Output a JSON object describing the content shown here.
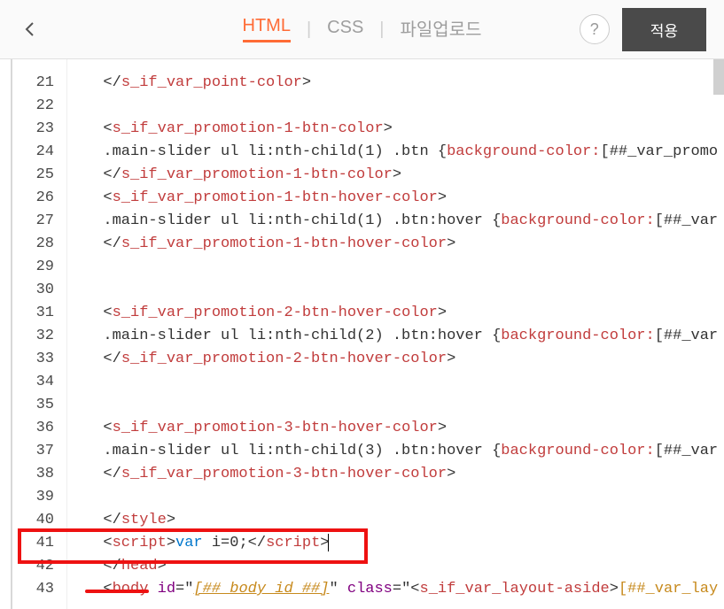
{
  "header": {
    "tabs": {
      "html": "HTML",
      "css": "CSS",
      "upload": "파일업로드"
    },
    "help": "?",
    "apply": "적용"
  },
  "lines": [
    {
      "n": 21,
      "segs": [
        {
          "t": "  </",
          "c": "c-plain"
        },
        {
          "t": "s_if_var_point-color",
          "c": "c-tag"
        },
        {
          "t": ">",
          "c": "c-plain"
        }
      ]
    },
    {
      "n": 22,
      "segs": []
    },
    {
      "n": 23,
      "segs": [
        {
          "t": "  <",
          "c": "c-plain"
        },
        {
          "t": "s_if_var_promotion-1-btn-color",
          "c": "c-tag"
        },
        {
          "t": ">",
          "c": "c-plain"
        }
      ]
    },
    {
      "n": 24,
      "segs": [
        {
          "t": "  .main-slider ul li:nth-child(1) .btn {",
          "c": "c-plain"
        },
        {
          "t": "background-color:",
          "c": "c-prop"
        },
        {
          "t": "[##_var_promo",
          "c": "c-plain"
        }
      ]
    },
    {
      "n": 25,
      "segs": [
        {
          "t": "  </",
          "c": "c-plain"
        },
        {
          "t": "s_if_var_promotion-1-btn-color",
          "c": "c-tag"
        },
        {
          "t": ">",
          "c": "c-plain"
        }
      ]
    },
    {
      "n": 26,
      "segs": [
        {
          "t": "  <",
          "c": "c-plain"
        },
        {
          "t": "s_if_var_promotion-1-btn-hover-color",
          "c": "c-tag"
        },
        {
          "t": ">",
          "c": "c-plain"
        }
      ]
    },
    {
      "n": 27,
      "segs": [
        {
          "t": "  .main-slider ul li:nth-child(1) .btn:hover {",
          "c": "c-plain"
        },
        {
          "t": "background-color:",
          "c": "c-prop"
        },
        {
          "t": "[##_var",
          "c": "c-plain"
        }
      ]
    },
    {
      "n": 28,
      "segs": [
        {
          "t": "  </",
          "c": "c-plain"
        },
        {
          "t": "s_if_var_promotion-1-btn-hover-color",
          "c": "c-tag"
        },
        {
          "t": ">",
          "c": "c-plain"
        }
      ]
    },
    {
      "n": 29,
      "segs": []
    },
    {
      "n": 30,
      "segs": []
    },
    {
      "n": 31,
      "segs": [
        {
          "t": "  <",
          "c": "c-plain"
        },
        {
          "t": "s_if_var_promotion-2-btn-hover-color",
          "c": "c-tag"
        },
        {
          "t": ">",
          "c": "c-plain"
        }
      ]
    },
    {
      "n": 32,
      "segs": [
        {
          "t": "  .main-slider ul li:nth-child(2) .btn:hover {",
          "c": "c-plain"
        },
        {
          "t": "background-color:",
          "c": "c-prop"
        },
        {
          "t": "[##_var",
          "c": "c-plain"
        }
      ]
    },
    {
      "n": 33,
      "segs": [
        {
          "t": "  </",
          "c": "c-plain"
        },
        {
          "t": "s_if_var_promotion-2-btn-hover-color",
          "c": "c-tag"
        },
        {
          "t": ">",
          "c": "c-plain"
        }
      ]
    },
    {
      "n": 34,
      "segs": []
    },
    {
      "n": 35,
      "segs": []
    },
    {
      "n": 36,
      "segs": [
        {
          "t": "  <",
          "c": "c-plain"
        },
        {
          "t": "s_if_var_promotion-3-btn-hover-color",
          "c": "c-tag"
        },
        {
          "t": ">",
          "c": "c-plain"
        }
      ]
    },
    {
      "n": 37,
      "segs": [
        {
          "t": "  .main-slider ul li:nth-child(3) .btn:hover {",
          "c": "c-plain"
        },
        {
          "t": "background-color:",
          "c": "c-prop"
        },
        {
          "t": "[##_var",
          "c": "c-plain"
        }
      ]
    },
    {
      "n": 38,
      "segs": [
        {
          "t": "  </",
          "c": "c-plain"
        },
        {
          "t": "s_if_var_promotion-3-btn-hover-color",
          "c": "c-tag"
        },
        {
          "t": ">",
          "c": "c-plain"
        }
      ]
    },
    {
      "n": 39,
      "segs": []
    },
    {
      "n": 40,
      "segs": [
        {
          "t": "  </",
          "c": "c-plain"
        },
        {
          "t": "style",
          "c": "c-tag"
        },
        {
          "t": ">",
          "c": "c-plain"
        }
      ]
    },
    {
      "n": 41,
      "segs": [
        {
          "t": "  <",
          "c": "c-plain"
        },
        {
          "t": "script",
          "c": "c-tag"
        },
        {
          "t": ">",
          "c": "c-plain"
        },
        {
          "t": "var",
          "c": "c-keyword"
        },
        {
          "t": " i=",
          "c": "c-plain"
        },
        {
          "t": "0",
          "c": "c-plain"
        },
        {
          "t": ";</",
          "c": "c-plain"
        },
        {
          "t": "script",
          "c": "c-tag"
        },
        {
          "t": ">",
          "c": "c-plain"
        }
      ],
      "cursor": true
    },
    {
      "n": 42,
      "segs": [
        {
          "t": "  </",
          "c": "c-plain"
        },
        {
          "t": "head",
          "c": "c-tag"
        },
        {
          "t": ">",
          "c": "c-plain"
        }
      ]
    },
    {
      "n": 43,
      "segs": [
        {
          "t": "  <",
          "c": "c-plain"
        },
        {
          "t": "body",
          "c": "c-tag"
        },
        {
          "t": " ",
          "c": "c-plain"
        },
        {
          "t": "id",
          "c": "c-attr"
        },
        {
          "t": "=\"",
          "c": "c-plain"
        },
        {
          "t": "[##_body_id_##]",
          "c": "c-str"
        },
        {
          "t": "\" ",
          "c": "c-plain"
        },
        {
          "t": "class",
          "c": "c-attr"
        },
        {
          "t": "=\"<",
          "c": "c-plain"
        },
        {
          "t": "s_if_var_layout-aside",
          "c": "c-tag"
        },
        {
          "t": ">",
          "c": "c-plain"
        },
        {
          "t": "[##_var_lay",
          "c": "c-val"
        }
      ]
    }
  ]
}
